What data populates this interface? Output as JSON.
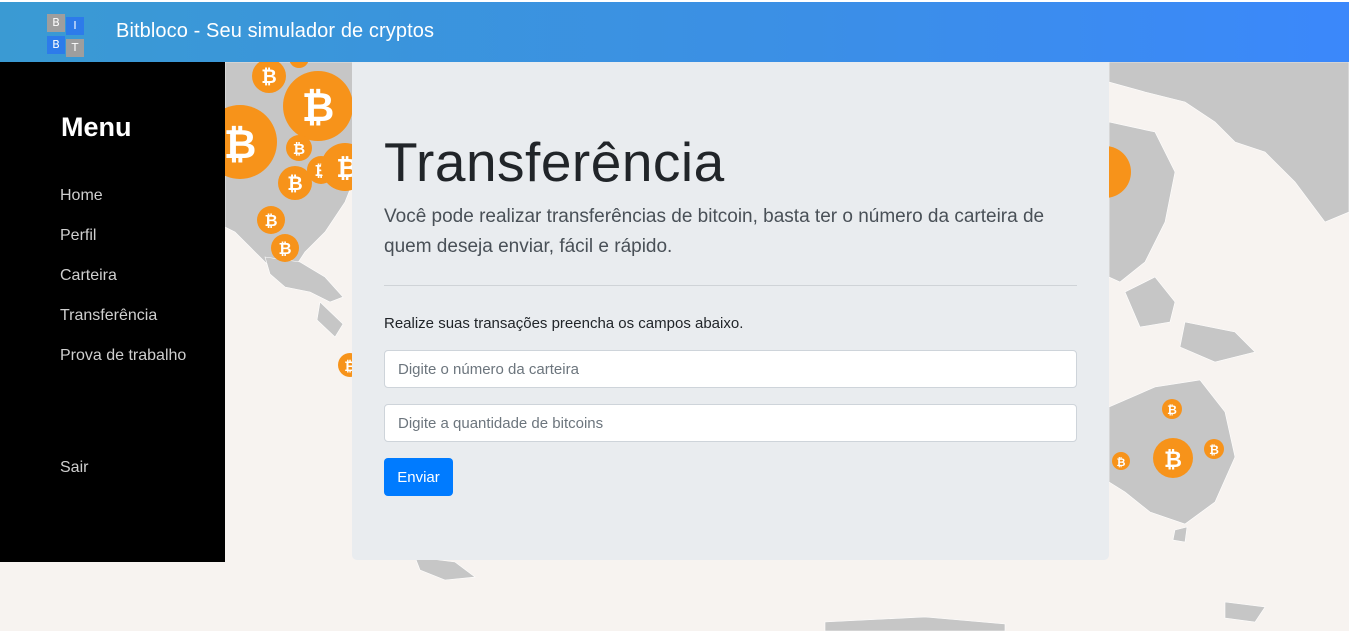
{
  "navbar": {
    "logo_letters": [
      "B",
      "I",
      "B",
      "T"
    ],
    "brand": "Bitbloco - Seu simulador de cryptos"
  },
  "sidebar": {
    "title": "Menu",
    "items": [
      {
        "label": "Home"
      },
      {
        "label": "Perfil"
      },
      {
        "label": "Carteira"
      },
      {
        "label": "Transferência"
      },
      {
        "label": "Prova de trabalho"
      }
    ],
    "logout": "Sair"
  },
  "main": {
    "heading": "Transferência",
    "lead": "Você pode realizar transferências de bitcoin, basta ter o número da carteira de quem deseja enviar, fácil e rápido.",
    "hint": "Realize suas transações preencha os campos abaixo.",
    "wallet_placeholder": "Digite o número da carteira",
    "wallet_value": "",
    "amount_placeholder": "Digite a quantidade de bitcoins",
    "amount_value": "",
    "submit_label": "Enviar"
  },
  "background": {
    "marker_icon": "bitcoin-icon",
    "marker_glyph": "₿"
  },
  "colors": {
    "navbar_start": "#3a9ad3",
    "navbar_end": "#3b88fb",
    "sidebar": "#000000",
    "card": "#e9ecef",
    "primary_button": "#007bff",
    "bitcoin_orange": "#f7931a",
    "map_land": "#c6c6c6",
    "map_water": "#f7f3f0"
  }
}
